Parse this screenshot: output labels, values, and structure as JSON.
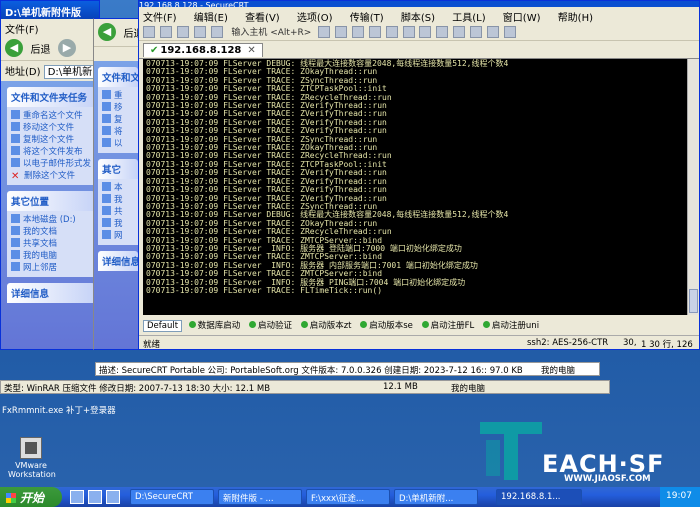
{
  "explorer_left": {
    "title": "D:\\单机新附件版",
    "menu_label": "文件(F)",
    "back_label": "后退",
    "address_label": "地址(D)",
    "address_value": "D:\\单机新",
    "file_tasks_title": "文件和文件夹任务",
    "file_tasks": [
      "重命名这个文件",
      "移动这个文件",
      "复制这个文件",
      "将这个文件发布",
      "以电子邮件形式发送此文件",
      "删除这个文件"
    ],
    "other_places_title": "其它位置",
    "other_places": [
      "本地磁盘 (D:)",
      "我的文档",
      "共享文档",
      "我的电脑",
      "网上邻居"
    ],
    "details_title": "详细信息"
  },
  "explorer_mid": {
    "back_label": "后退",
    "file_tasks_title": "文件和文件夹任务",
    "items": [
      "重",
      "移",
      "复",
      "将",
      "以"
    ],
    "other_title": "其它",
    "other_items": [
      "本",
      "我",
      "共",
      "我",
      "网"
    ],
    "details_title": "详细信息"
  },
  "crt": {
    "title": "192.168.8.128 - SecureCRT",
    "menu": [
      "文件(F)",
      "编辑(E)",
      "查看(V)",
      "选项(O)",
      "传输(T)",
      "脚本(S)",
      "工具(L)",
      "窗口(W)",
      "帮助(H)"
    ],
    "host_placeholder": "输入主机 <Alt+R>",
    "tab_label": "192.168.8.128",
    "terminal_lines": [
      "070713-19:07:09 FLServer DEBUG: 线程最大连接数容量2048,每线程连接数量512,线程个数4",
      "070713-19:07:09 FLServer TRACE: ZOkayThread::run",
      "070713-19:07:09 FLServer TRACE: ZSyncThread::run",
      "070713-19:07:09 FLServer TRACE: ZTCPTaskPool::init",
      "070713-19:07:09 FLServer TRACE: ZRecycleThread::run",
      "070713-19:07:09 FLServer TRACE: ZVerifyThread::run",
      "070713-19:07:09 FLServer TRACE: ZVerifyThread::run",
      "070713-19:07:09 FLServer TRACE: ZVerifyThread::run",
      "070713-19:07:09 FLServer TRACE: ZVerifyThread::run",
      "070713-19:07:09 FLServer TRACE: ZSyncThread::run",
      "070713-19:07:09 FLServer TRACE: ZOkayThread::run",
      "070713-19:07:09 FLServer TRACE: ZRecycleThread::run",
      "070713-19:07:09 FLServer TRACE: ZTCPTaskPool::init",
      "070713-19:07:09 FLServer TRACE: ZVerifyThread::run",
      "070713-19:07:09 FLServer TRACE: ZVerifyThread::run",
      "070713-19:07:09 FLServer TRACE: ZVerifyThread::run",
      "070713-19:07:09 FLServer TRACE: ZVerifyThread::run",
      "070713-19:07:09 FLServer TRACE: ZSyncThread::run",
      "070713-19:07:09 FLServer DEBUG: 线程最大连接数容量2048,每线程连接数量512,线程个数4",
      "070713-19:07:09 FLServer TRACE: ZOkayThread::run",
      "070713-19:07:09 FLServer TRACE: ZRecycleThread::run",
      "070713-19:07:09 FLServer TRACE: ZMTCPServer::bind",
      "070713-19:07:09 FLServer  INFO: 服务器 登陆端口:7000 端口初始化绑定成功",
      "070713-19:07:09 FLServer TRACE: ZMTCPServer::bind",
      "070713-19:07:09 FLServer  INFO: 服务器 内部服务端口:7001 端口初始化绑定成功",
      "070713-19:07:09 FLServer TRACE: ZMTCPServer::bind",
      "070713-19:07:09 FLServer  INFO: 服务器 PING端口:7004 端口初始化绑定成功",
      "070713-19:07:09 FLServer TRACE: FLTimeTick::run()"
    ],
    "command_select": "Default",
    "commands": [
      "数据库启动",
      "启动验证",
      "启动版本zt",
      "启动版本se",
      "启动注册FL",
      "启动注册uni"
    ],
    "status_ready": "就绪",
    "status_ssh": "ssh2: AES-256-CTR",
    "status_rows": "30,",
    "status_cols": "1 30 行, 126"
  },
  "desc_bar": {
    "text": "描述: SecureCRT Portable 公司: PortableSoft.org 文件版本: 7.0.0.326 创建日期: 2023-7-12 16:: 97.0 KB",
    "location": "我的电脑"
  },
  "desc_bar2": {
    "text": "类型: WinRAR 压缩文件 修改日期: 2007-7-13 18:30 大小: 12.1 MB",
    "size": "12.1 MB",
    "location": "我的电脑"
  },
  "desktop": {
    "top_label": "FxRmmnit.exe 补丁+登录器",
    "icon_label": "VMware Workstation"
  },
  "logo": {
    "word": "EACH·SF",
    "url": "WWW.JIAOSF.COM"
  },
  "taskbar": {
    "start_label": "开始",
    "buttons": [
      "D:\\SecureCRT",
      "新附件版 - ...",
      "F:\\xxx\\征途...",
      "D:\\单机新附...",
      "192.168.8.1..."
    ],
    "clock": "19:07"
  },
  "colors": {
    "terminal_fg": "#e4e4a8",
    "terminal_bg": "#000000",
    "xp_blue": "#0a5fe0",
    "logo_teal": "#0f9aa5"
  }
}
